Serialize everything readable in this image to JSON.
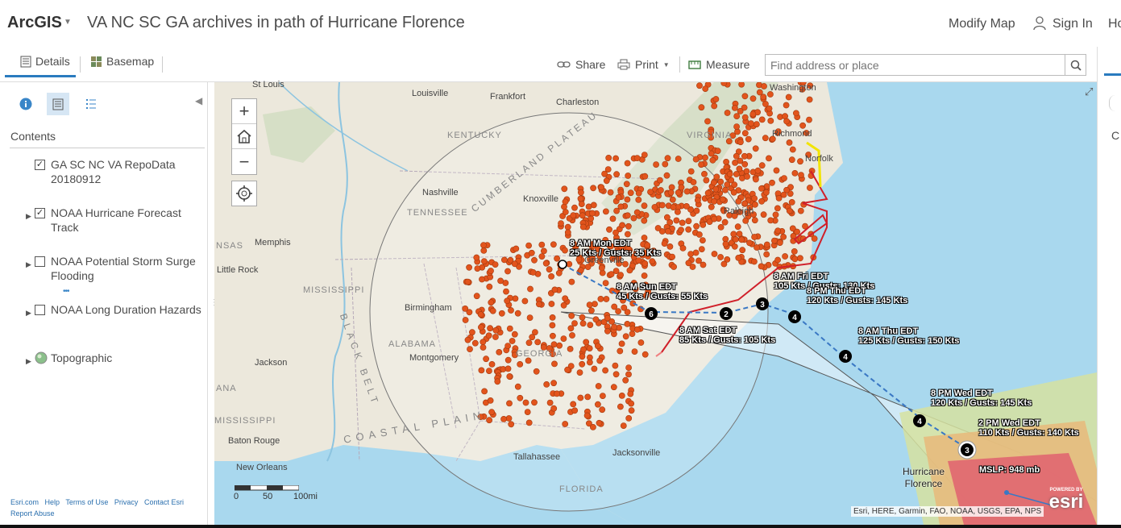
{
  "header": {
    "brand": "ArcGIS",
    "title": "VA NC SC GA archives in path of Hurricane Florence",
    "modify_map": "Modify Map",
    "sign_in": "Sign In",
    "home_cut": "Ho"
  },
  "toolbar": {
    "details": "Details",
    "basemap": "Basemap",
    "share": "Share",
    "print": "Print",
    "measure": "Measure",
    "search_placeholder": "Find address or place"
  },
  "panel": {
    "contents_title": "Contents",
    "layers": [
      {
        "label": "GA SC NC VA RepoData 20180912",
        "checked": true,
        "expandable": false
      },
      {
        "label": "NOAA Hurricane Forecast Track",
        "checked": true,
        "expandable": true
      },
      {
        "label": "NOAA Potential Storm Surge Flooding",
        "checked": false,
        "expandable": true
      },
      {
        "label": "NOAA Long Duration Hazards",
        "checked": false,
        "expandable": true
      },
      {
        "label": "Topographic",
        "checked": null,
        "expandable": true
      }
    ],
    "footer_links": [
      "Esri.com",
      "Help",
      "Terms of Use",
      "Privacy",
      "Contact Esri",
      "Report Abuse"
    ]
  },
  "map": {
    "cities": [
      "St Louis",
      "Louisville",
      "Frankfort",
      "Charleston",
      "Richmond",
      "Norfolk",
      "Nashville",
      "Knoxville",
      "Memphis",
      "Little Rock",
      "Birmingham",
      "Montgomery",
      "Jackson",
      "Baton Rouge",
      "New Orleans",
      "Tallahassee",
      "Jacksonville",
      "Greenville",
      "Raleigh",
      "Washington"
    ],
    "states": [
      "KENTUCKY",
      "TENNESSEE",
      "MISSISSIPPI",
      "ALABAMA",
      "GEORGIA",
      "FLORIDA",
      "VIRGINIA",
      "CUMBERLAND PLATEAU",
      "BLACK BELT",
      "COASTAL PLAIN",
      "NSAS",
      "ANA",
      "MISSISSIPPI"
    ],
    "forecast_labels": [
      {
        "time": "8 AM Mon EDT",
        "wind": "25 Kts / Gusts: 35 Kts"
      },
      {
        "time": "8 AM Sun EDT",
        "wind": "45 Kts / Gusts: 55 Kts"
      },
      {
        "time": "8 AM Sat EDT",
        "wind": "85 Kts / Gusts: 105 Kts"
      },
      {
        "time": "8 AM Fri EDT",
        "wind": "105 Kts / Gusts: 130 Kts"
      },
      {
        "time": "8 PM Thu EDT",
        "wind": "120 Kts / Gusts: 145 Kts"
      },
      {
        "time": "8 AM Thu EDT",
        "wind": "125 Kts / Gusts: 150 Kts"
      },
      {
        "time": "8 PM Wed EDT",
        "wind": "120 Kts / Gusts: 145 Kts"
      },
      {
        "time": "2 PM Wed EDT",
        "wind": "110 Kts / Gusts: 140 Kts"
      }
    ],
    "storm_name_1": "Hurricane",
    "storm_name_2": "Florence",
    "mslp": "MSLP: 948 mb",
    "attribution": "Esri, HERE, Garmin, FAO, NOAA, USGS, EPA, NPS",
    "scale": {
      "zero": "0",
      "mid": "50",
      "end": "100mi"
    },
    "esri_powered": "POWERED BY",
    "esri_logo": "esri",
    "colors": {
      "water": "#a9d8ee",
      "land": "#ebe7dc",
      "dot": "#e2541c",
      "track_red": "#d0202a",
      "track_blue": "#3a78c4"
    }
  }
}
